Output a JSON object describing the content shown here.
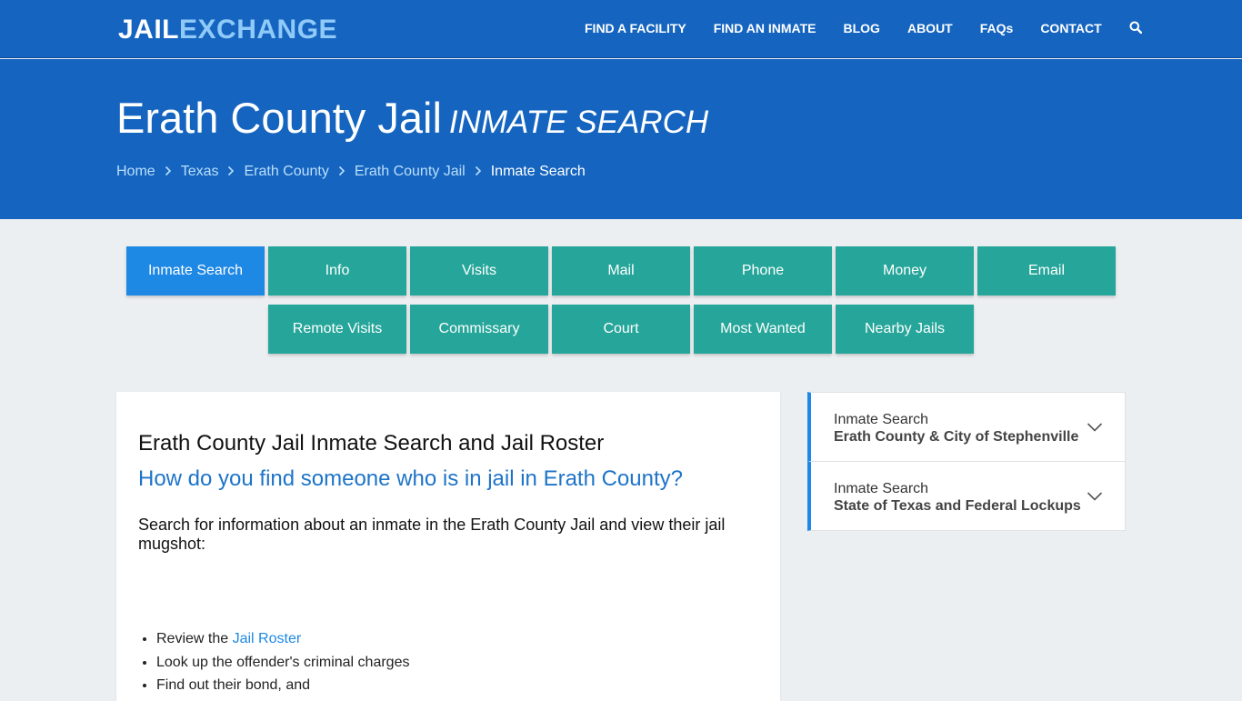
{
  "header": {
    "logo_part1": "JAIL",
    "logo_part2": "EXCHANGE",
    "nav": [
      "FIND A FACILITY",
      "FIND AN INMATE",
      "BLOG",
      "ABOUT",
      "FAQs",
      "CONTACT"
    ],
    "search_icon": "search-icon"
  },
  "hero": {
    "title": "Erath County Jail",
    "subtitle": "INMATE SEARCH",
    "breadcrumbs": [
      "Home",
      "Texas",
      "Erath County",
      "Erath County Jail"
    ],
    "breadcrumb_current": "Inmate Search"
  },
  "tabs": {
    "row1": [
      "Inmate Search",
      "Info",
      "Visits",
      "Mail",
      "Phone",
      "Money",
      "Email"
    ],
    "row2": [
      "Remote Visits",
      "Commissary",
      "Court",
      "Most Wanted",
      "Nearby Jails"
    ],
    "active": "Inmate Search"
  },
  "main": {
    "heading": "Erath County Jail Inmate Search and Jail Roster",
    "question": "How do you find someone who is in jail in Erath County?",
    "lead": "Search for information about an inmate in the Erath County Jail and view their jail mugshot:",
    "list": {
      "item1_prefix": "Review the ",
      "item1_link": "Jail Roster",
      "item2": "Look up the offender's criminal charges",
      "item3": "Find out their bond, and"
    }
  },
  "sidebar": {
    "items": [
      {
        "line1": "Inmate Search",
        "line2": "Erath County & City of Stephenville"
      },
      {
        "line1": "Inmate Search",
        "line2": "State of Texas and Federal Lockups"
      }
    ]
  },
  "colors": {
    "header_blue": "#1565c0",
    "tab_teal": "#26a69a",
    "tab_active": "#1e88e5",
    "link_blue": "#1e74c8"
  }
}
